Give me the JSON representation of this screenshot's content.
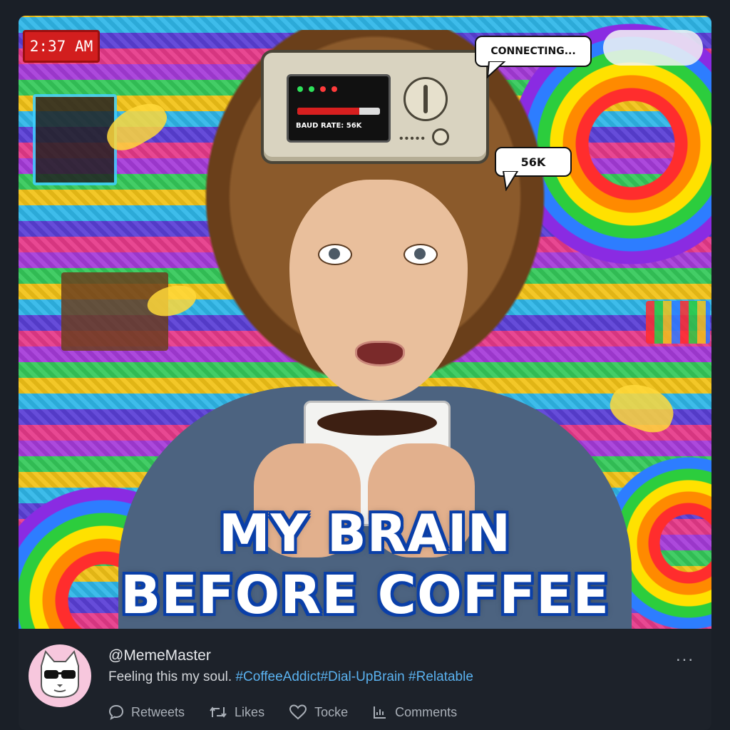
{
  "meme": {
    "time": "2:37 AM",
    "bubble_connecting": "CONNECTING...",
    "bubble_56k": "56K",
    "modem_label": "BAUD RATE: 56K",
    "modem_progress": 0.75,
    "caption_line1": "MY BRAIN",
    "caption_line2": "BEFORE COFFEE"
  },
  "post": {
    "username": "@MemeMaster",
    "text": "Feeling this my soul.",
    "hashtags": [
      "#CoffeeAddict",
      "#Dial-UpBrain",
      "#Relatable"
    ],
    "more_label": "...",
    "actions": [
      {
        "label": "Retweets",
        "icon": "comment-bubble-icon"
      },
      {
        "label": "Likes",
        "icon": "retweet-icon"
      },
      {
        "label": "Tocke",
        "icon": "heart-icon"
      },
      {
        "label": "Comments",
        "icon": "chart-icon"
      }
    ]
  },
  "colors": {
    "hashtag": "#5ab2f0",
    "caption_outline": "#0a3fa8",
    "time_badge": "#d21e1e",
    "background": "#1a1f27"
  }
}
